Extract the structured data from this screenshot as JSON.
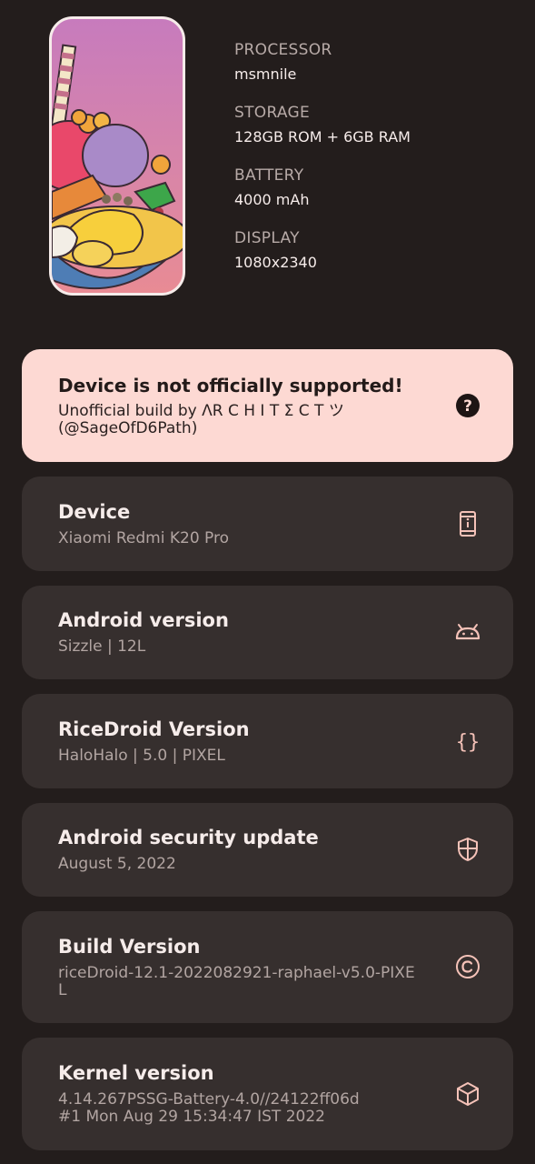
{
  "specs": [
    {
      "label": "PROCESSOR",
      "value": "msmnile"
    },
    {
      "label": "STORAGE",
      "value": "128GB ROM + 6GB RAM"
    },
    {
      "label": "BATTERY",
      "value": "4000 mAh"
    },
    {
      "label": "DISPLAY",
      "value": "1080x2340"
    }
  ],
  "warning": {
    "title": "Device is not officially supported!",
    "subtitle": "Unofficial build by ΛR C H I T Σ C T ツ (@SageOfD6Path)",
    "icon": "help-icon"
  },
  "cards": [
    {
      "title": "Device",
      "subtitle": "Xiaomi Redmi K20 Pro",
      "icon": "phone-icon"
    },
    {
      "title": "Android version",
      "subtitle": "Sizzle | 12L",
      "icon": "android-icon"
    },
    {
      "title": "RiceDroid Version",
      "subtitle": "HaloHalo | 5.0 | PIXEL",
      "icon": "braces-icon"
    },
    {
      "title": "Android security update",
      "subtitle": "August 5, 2022",
      "icon": "shield-icon"
    },
    {
      "title": "Build Version",
      "subtitle": "riceDroid-12.1-2022082921-raphael-v5.0-PIXEL",
      "icon": "copyright-icon"
    },
    {
      "title": "Kernel version",
      "subtitle": "4.14.267PSSG-Battery-4.0//24122ff06d\n#1 Mon Aug 29 15:34:47 IST 2022",
      "icon": "cube-icon"
    }
  ]
}
